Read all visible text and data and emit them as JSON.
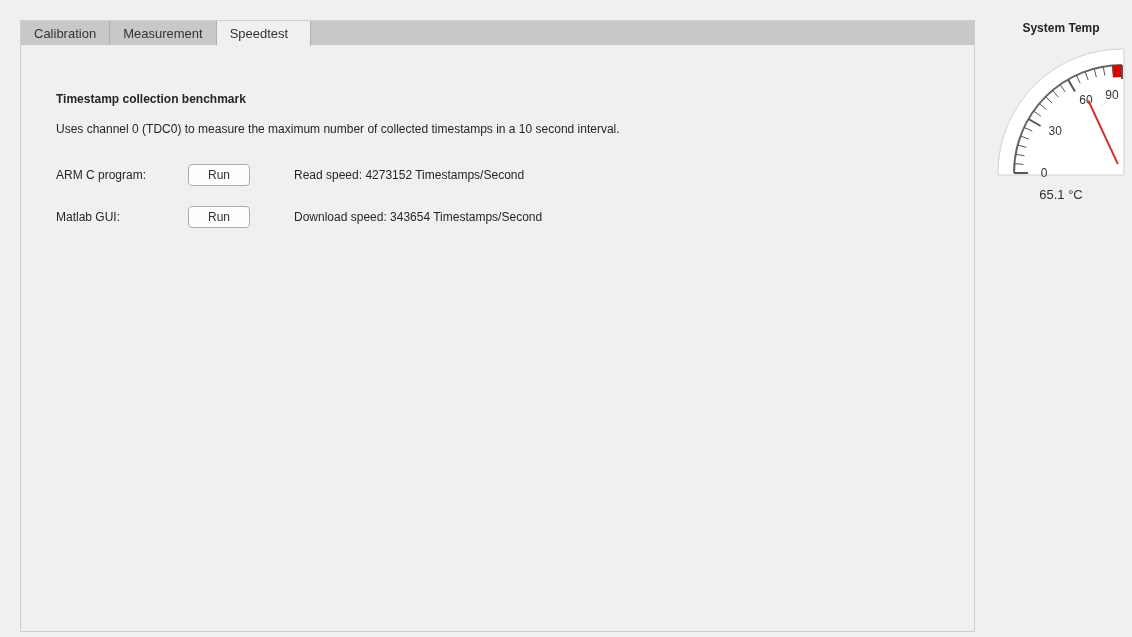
{
  "tabs": [
    {
      "label": "Calibration",
      "selected": false
    },
    {
      "label": "Measurement",
      "selected": false
    },
    {
      "label": "Speedtest",
      "selected": true
    }
  ],
  "section": {
    "title": "Timestamp collection benchmark",
    "description": "Uses channel 0 (TDC0) to measure the maximum number of collected timestamps in a 10 second interval.",
    "rows": [
      {
        "label": "ARM C program:",
        "button": "Run",
        "result": "Read speed: 4273152 Timestamps/Second"
      },
      {
        "label": "Matlab GUI:",
        "button": "Run",
        "result": "Download speed: 343654 Timestamps/Second"
      }
    ]
  },
  "gauge": {
    "title": "System Temp",
    "ticks": [
      "0",
      "30",
      "60",
      "90"
    ],
    "reading": "65.1 °C"
  }
}
